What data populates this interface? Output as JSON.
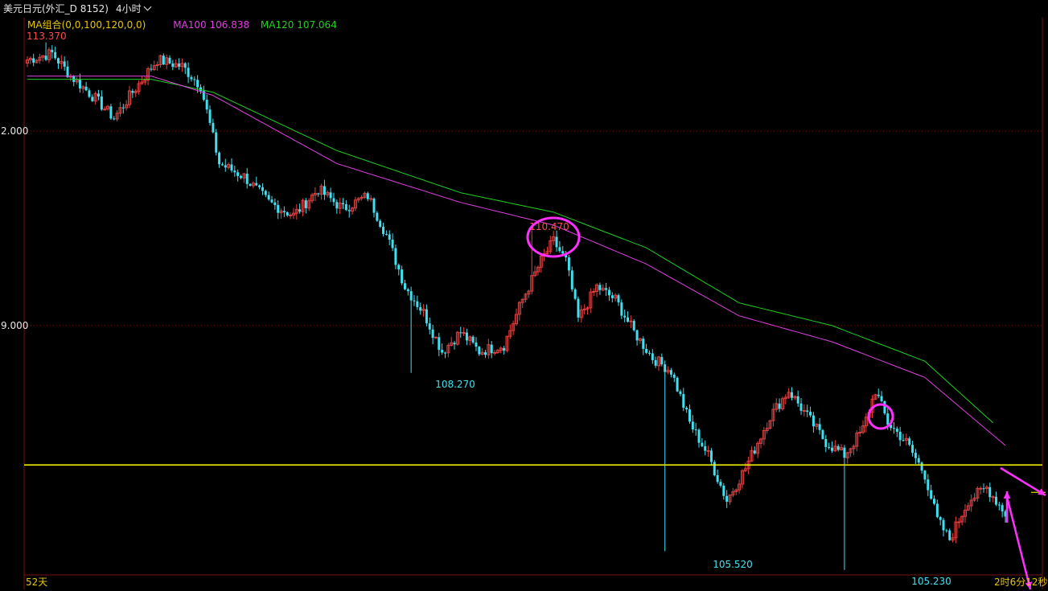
{
  "header": {
    "title": "美元日元(外汇_D 8152)",
    "period": "4小时"
  },
  "ma": {
    "group_label": "MA组合(0,0,100,120,0,0)",
    "ma100_label": "MA100 106.838",
    "ma120_label": "MA120 107.064",
    "group_color": "#e8c600",
    "ma100_color": "#e040e0",
    "ma120_color": "#20d020"
  },
  "footer": {
    "left_label": "52天",
    "right_label": "2时6分12秒"
  },
  "colors": {
    "up": "#e04040",
    "down": "#40e0f0",
    "grid": "#7a1010",
    "axis": "#7a1010",
    "hline": "#ffff00",
    "annot": "#ff30ff"
  },
  "chart_data": {
    "type": "candlestick",
    "y_ticks": [
      {
        "value": 112.0,
        "label": "2.000"
      },
      {
        "value": 109.0,
        "label": "9.000"
      }
    ],
    "ylim": [
      104.93,
      113.75
    ],
    "annotations": [
      {
        "label": "113.370",
        "value": 113.37,
        "color": "#ff4a4a"
      },
      {
        "label": "110.470",
        "value": 110.47,
        "color": "#ff4a4a"
      },
      {
        "label": "108.270",
        "value": 108.27,
        "color": "#40e0f0"
      },
      {
        "label": "105.520",
        "value": 105.52,
        "color": "#40e0f0"
      },
      {
        "label": "105.230",
        "value": 105.23,
        "color": "#40e0f0"
      }
    ],
    "horizontal_line": 106.85,
    "waypoints": [
      [
        0,
        113.1
      ],
      [
        8,
        113.2
      ],
      [
        14,
        112.85
      ],
      [
        22,
        112.5
      ],
      [
        28,
        112.2
      ],
      [
        34,
        112.6
      ],
      [
        42,
        113.1
      ],
      [
        50,
        113.0
      ],
      [
        56,
        112.7
      ],
      [
        62,
        111.5
      ],
      [
        70,
        111.3
      ],
      [
        78,
        110.9
      ],
      [
        86,
        110.7
      ],
      [
        94,
        111.1
      ],
      [
        102,
        110.8
      ],
      [
        110,
        111.0
      ],
      [
        116,
        110.4
      ],
      [
        122,
        109.6
      ],
      [
        128,
        109.2
      ],
      [
        134,
        108.6
      ],
      [
        140,
        108.9
      ],
      [
        146,
        108.6
      ],
      [
        154,
        108.7
      ],
      [
        160,
        109.4
      ],
      [
        166,
        110.0
      ],
      [
        170,
        110.3
      ],
      [
        174,
        110.0
      ],
      [
        178,
        109.1
      ],
      [
        184,
        109.6
      ],
      [
        190,
        109.4
      ],
      [
        196,
        108.9
      ],
      [
        202,
        108.5
      ],
      [
        208,
        108.3
      ],
      [
        214,
        107.5
      ],
      [
        220,
        107.0
      ],
      [
        226,
        106.3
      ],
      [
        232,
        106.8
      ],
      [
        240,
        107.6
      ],
      [
        246,
        108.0
      ],
      [
        252,
        107.6
      ],
      [
        258,
        107.2
      ],
      [
        264,
        107.0
      ],
      [
        270,
        107.4
      ],
      [
        274,
        108.0
      ],
      [
        278,
        107.5
      ],
      [
        284,
        107.2
      ],
      [
        290,
        106.7
      ],
      [
        294,
        106.0
      ],
      [
        298,
        105.7
      ],
      [
        304,
        106.3
      ],
      [
        310,
        106.5
      ],
      [
        316,
        106.1
      ]
    ],
    "ma100_points": [
      [
        0,
        112.85
      ],
      [
        40,
        112.85
      ],
      [
        60,
        112.55
      ],
      [
        100,
        111.5
      ],
      [
        140,
        110.9
      ],
      [
        170,
        110.55
      ],
      [
        200,
        109.95
      ],
      [
        230,
        109.15
      ],
      [
        260,
        108.75
      ],
      [
        290,
        108.2
      ],
      [
        316,
        107.15
      ]
    ],
    "ma120_points": [
      [
        0,
        112.8
      ],
      [
        40,
        112.8
      ],
      [
        60,
        112.6
      ],
      [
        100,
        111.7
      ],
      [
        140,
        111.05
      ],
      [
        170,
        110.75
      ],
      [
        200,
        110.2
      ],
      [
        230,
        109.35
      ],
      [
        260,
        109.0
      ],
      [
        290,
        108.45
      ],
      [
        312,
        107.5
      ]
    ]
  }
}
